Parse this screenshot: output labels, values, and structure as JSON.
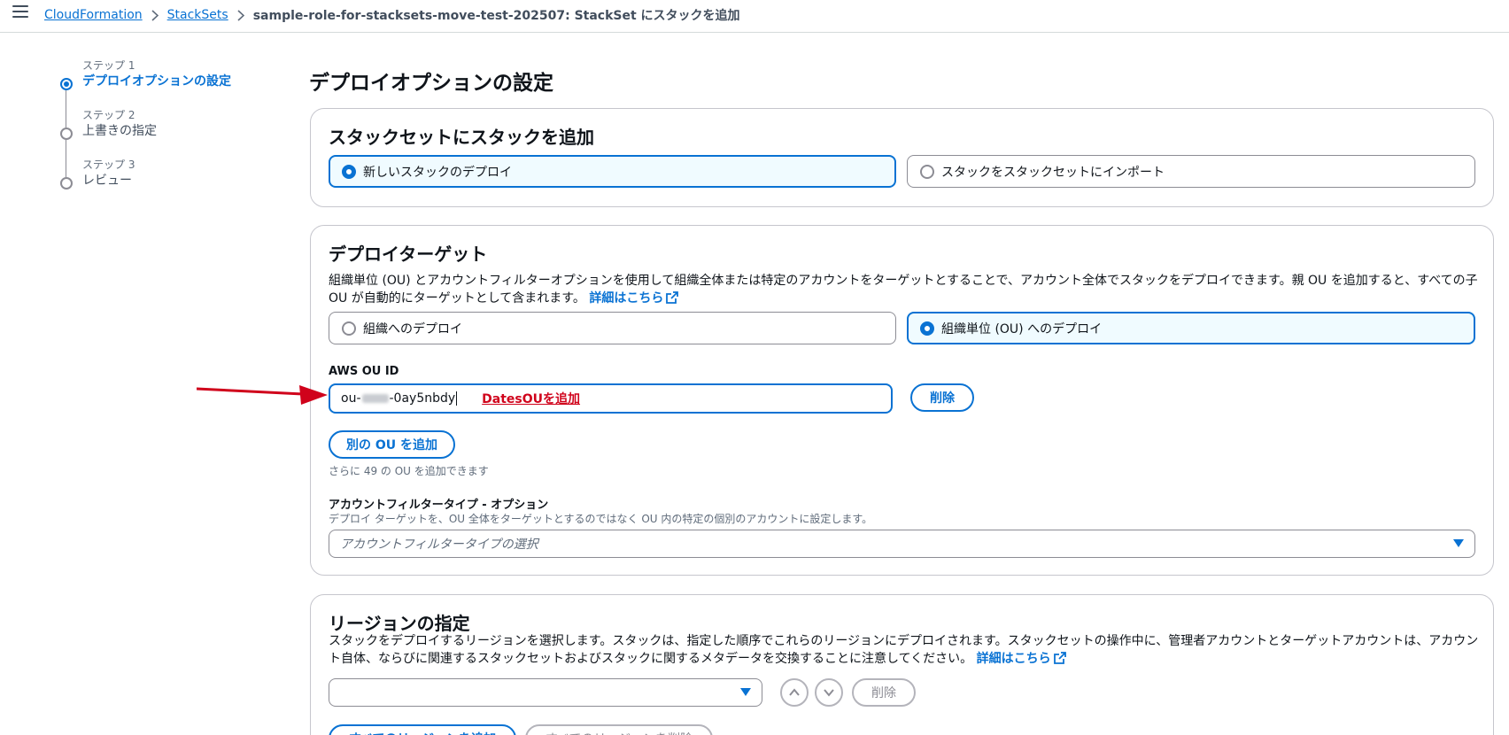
{
  "breadcrumbs": {
    "cloudformation": "CloudFormation",
    "stacksets": "StackSets",
    "current": "sample-role-for-stacksets-move-test-202507: StackSet にスタックを追加"
  },
  "steps": [
    {
      "num": "ステップ 1",
      "label": "デプロイオプションの設定",
      "active": true
    },
    {
      "num": "ステップ 2",
      "label": "上書きの指定",
      "active": false
    },
    {
      "num": "ステップ 3",
      "label": "レビュー",
      "active": false
    }
  ],
  "page_title": "デプロイオプションの設定",
  "add_stacks": {
    "title": "スタックセットにスタックを追加",
    "option_new": "新しいスタックのデプロイ",
    "option_import": "スタックをスタックセットにインポート",
    "selected": "option_new"
  },
  "deploy_target": {
    "title": "デプロイターゲット",
    "description": "組織単位 (OU) とアカウントフィルターオプションを使用して組織全体または特定のアカウントをターゲットとすることで、アカウント全体でスタックをデプロイできます。親 OU を追加すると、すべての子 OU が自動的にターゲットとして含まれます。",
    "learn_more": "詳細はこちら",
    "option_org": "組織へのデプロイ",
    "option_ou": "組織単位 (OU) へのデプロイ",
    "selected": "option_ou",
    "ou_label": "AWS OU ID",
    "ou_prefix": "ou-",
    "ou_suffix": "-0ay5nbdy",
    "annotation": "DatesOUを追加",
    "remove_button": "削除",
    "add_ou_button": "別の OU を追加",
    "add_ou_hint": "さらに 49 の OU を追加できます",
    "filter_label": "アカウントフィルタータイプ - オプション",
    "filter_hint": "デプロイ ターゲットを、OU 全体をターゲットとするのではなく OU 内の特定の個別のアカウントに設定します。",
    "filter_placeholder": "アカウントフィルタータイプの選択"
  },
  "regions": {
    "title": "リージョンの指定",
    "description": "スタックをデプロイするリージョンを選択します。スタックは、指定した順序でこれらのリージョンにデプロイされます。スタックセットの操作中に、管理者アカウントとターゲットアカウントは、アカウント自体、ならびに関連するスタックセットおよびスタックに関するメタデータを交換することに注意してください。",
    "learn_more": "詳細はこちら",
    "remove_button": "削除",
    "add_all_button": "すべてのリージョンを追加",
    "remove_all_button": "すべてのリージョンを削除"
  },
  "colors": {
    "accent": "#0972d3",
    "annotation": "#d0021b",
    "selected_bg": "#f0fbff"
  },
  "icons": [
    "menu-icon",
    "chevron-right-icon",
    "external-link-icon",
    "caret-down-icon",
    "chevron-up-icon",
    "chevron-down-icon",
    "red-arrow"
  ]
}
